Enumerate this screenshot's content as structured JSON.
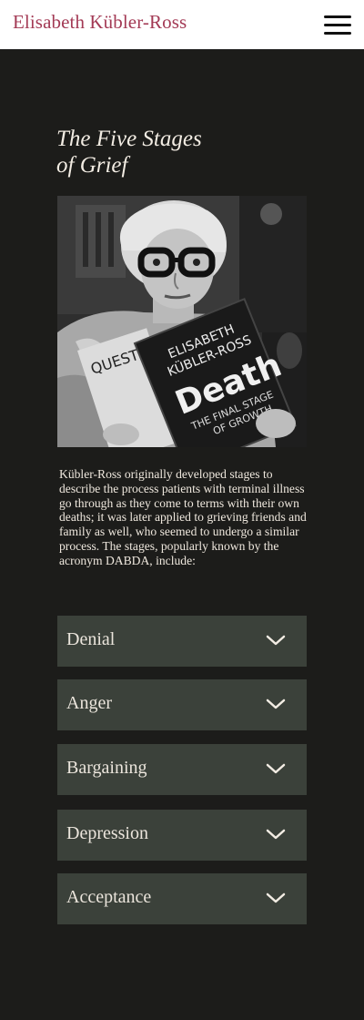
{
  "header": {
    "site_title": "Elisabeth Kübler-Ross",
    "menu_icon": "hamburger-menu-icon"
  },
  "main": {
    "heading_line1": "The Five Stages",
    "heading_line2": "of Grief",
    "photo": {
      "book1_line1": "ELISABETH",
      "book1_line2": "KÜBLER-ROSS",
      "book1_title": "Death",
      "book1_sub1": "THE FINAL STAGE",
      "book1_sub2": "OF GROWTH",
      "book2_text": "QUEST ANA ON"
    },
    "intro": "Kübler-Ross originally developed stages to describe the process patients with terminal illness go through as they come to terms with their own deaths; it was later applied to grieving friends and family as well, who seemed to undergo a similar process. The stages, popularly known by the acronym DABDA, include:",
    "stages": [
      {
        "label": "Denial"
      },
      {
        "label": "Anger"
      },
      {
        "label": "Bargaining"
      },
      {
        "label": "Depression"
      },
      {
        "label": "Acceptance"
      }
    ],
    "expand_icon": "chevron-down-icon"
  },
  "colors": {
    "brand": "#a33a55",
    "page_background": "#1c1c1a",
    "accordion_background": "#3b413a",
    "text_light": "#efe8de"
  }
}
